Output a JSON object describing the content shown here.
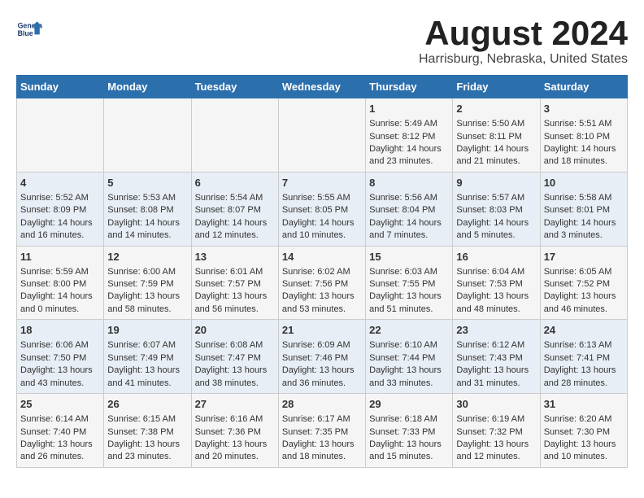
{
  "header": {
    "logo_line1": "General",
    "logo_line2": "Blue",
    "main_title": "August 2024",
    "subtitle": "Harrisburg, Nebraska, United States"
  },
  "days_of_week": [
    "Sunday",
    "Monday",
    "Tuesday",
    "Wednesday",
    "Thursday",
    "Friday",
    "Saturday"
  ],
  "weeks": [
    [
      {
        "day": "",
        "sunrise": "",
        "sunset": "",
        "daylight": ""
      },
      {
        "day": "",
        "sunrise": "",
        "sunset": "",
        "daylight": ""
      },
      {
        "day": "",
        "sunrise": "",
        "sunset": "",
        "daylight": ""
      },
      {
        "day": "",
        "sunrise": "",
        "sunset": "",
        "daylight": ""
      },
      {
        "day": "1",
        "sunrise": "Sunrise: 5:49 AM",
        "sunset": "Sunset: 8:12 PM",
        "daylight": "Daylight: 14 hours and 23 minutes."
      },
      {
        "day": "2",
        "sunrise": "Sunrise: 5:50 AM",
        "sunset": "Sunset: 8:11 PM",
        "daylight": "Daylight: 14 hours and 21 minutes."
      },
      {
        "day": "3",
        "sunrise": "Sunrise: 5:51 AM",
        "sunset": "Sunset: 8:10 PM",
        "daylight": "Daylight: 14 hours and 18 minutes."
      }
    ],
    [
      {
        "day": "4",
        "sunrise": "Sunrise: 5:52 AM",
        "sunset": "Sunset: 8:09 PM",
        "daylight": "Daylight: 14 hours and 16 minutes."
      },
      {
        "day": "5",
        "sunrise": "Sunrise: 5:53 AM",
        "sunset": "Sunset: 8:08 PM",
        "daylight": "Daylight: 14 hours and 14 minutes."
      },
      {
        "day": "6",
        "sunrise": "Sunrise: 5:54 AM",
        "sunset": "Sunset: 8:07 PM",
        "daylight": "Daylight: 14 hours and 12 minutes."
      },
      {
        "day": "7",
        "sunrise": "Sunrise: 5:55 AM",
        "sunset": "Sunset: 8:05 PM",
        "daylight": "Daylight: 14 hours and 10 minutes."
      },
      {
        "day": "8",
        "sunrise": "Sunrise: 5:56 AM",
        "sunset": "Sunset: 8:04 PM",
        "daylight": "Daylight: 14 hours and 7 minutes."
      },
      {
        "day": "9",
        "sunrise": "Sunrise: 5:57 AM",
        "sunset": "Sunset: 8:03 PM",
        "daylight": "Daylight: 14 hours and 5 minutes."
      },
      {
        "day": "10",
        "sunrise": "Sunrise: 5:58 AM",
        "sunset": "Sunset: 8:01 PM",
        "daylight": "Daylight: 14 hours and 3 minutes."
      }
    ],
    [
      {
        "day": "11",
        "sunrise": "Sunrise: 5:59 AM",
        "sunset": "Sunset: 8:00 PM",
        "daylight": "Daylight: 14 hours and 0 minutes."
      },
      {
        "day": "12",
        "sunrise": "Sunrise: 6:00 AM",
        "sunset": "Sunset: 7:59 PM",
        "daylight": "Daylight: 13 hours and 58 minutes."
      },
      {
        "day": "13",
        "sunrise": "Sunrise: 6:01 AM",
        "sunset": "Sunset: 7:57 PM",
        "daylight": "Daylight: 13 hours and 56 minutes."
      },
      {
        "day": "14",
        "sunrise": "Sunrise: 6:02 AM",
        "sunset": "Sunset: 7:56 PM",
        "daylight": "Daylight: 13 hours and 53 minutes."
      },
      {
        "day": "15",
        "sunrise": "Sunrise: 6:03 AM",
        "sunset": "Sunset: 7:55 PM",
        "daylight": "Daylight: 13 hours and 51 minutes."
      },
      {
        "day": "16",
        "sunrise": "Sunrise: 6:04 AM",
        "sunset": "Sunset: 7:53 PM",
        "daylight": "Daylight: 13 hours and 48 minutes."
      },
      {
        "day": "17",
        "sunrise": "Sunrise: 6:05 AM",
        "sunset": "Sunset: 7:52 PM",
        "daylight": "Daylight: 13 hours and 46 minutes."
      }
    ],
    [
      {
        "day": "18",
        "sunrise": "Sunrise: 6:06 AM",
        "sunset": "Sunset: 7:50 PM",
        "daylight": "Daylight: 13 hours and 43 minutes."
      },
      {
        "day": "19",
        "sunrise": "Sunrise: 6:07 AM",
        "sunset": "Sunset: 7:49 PM",
        "daylight": "Daylight: 13 hours and 41 minutes."
      },
      {
        "day": "20",
        "sunrise": "Sunrise: 6:08 AM",
        "sunset": "Sunset: 7:47 PM",
        "daylight": "Daylight: 13 hours and 38 minutes."
      },
      {
        "day": "21",
        "sunrise": "Sunrise: 6:09 AM",
        "sunset": "Sunset: 7:46 PM",
        "daylight": "Daylight: 13 hours and 36 minutes."
      },
      {
        "day": "22",
        "sunrise": "Sunrise: 6:10 AM",
        "sunset": "Sunset: 7:44 PM",
        "daylight": "Daylight: 13 hours and 33 minutes."
      },
      {
        "day": "23",
        "sunrise": "Sunrise: 6:12 AM",
        "sunset": "Sunset: 7:43 PM",
        "daylight": "Daylight: 13 hours and 31 minutes."
      },
      {
        "day": "24",
        "sunrise": "Sunrise: 6:13 AM",
        "sunset": "Sunset: 7:41 PM",
        "daylight": "Daylight: 13 hours and 28 minutes."
      }
    ],
    [
      {
        "day": "25",
        "sunrise": "Sunrise: 6:14 AM",
        "sunset": "Sunset: 7:40 PM",
        "daylight": "Daylight: 13 hours and 26 minutes."
      },
      {
        "day": "26",
        "sunrise": "Sunrise: 6:15 AM",
        "sunset": "Sunset: 7:38 PM",
        "daylight": "Daylight: 13 hours and 23 minutes."
      },
      {
        "day": "27",
        "sunrise": "Sunrise: 6:16 AM",
        "sunset": "Sunset: 7:36 PM",
        "daylight": "Daylight: 13 hours and 20 minutes."
      },
      {
        "day": "28",
        "sunrise": "Sunrise: 6:17 AM",
        "sunset": "Sunset: 7:35 PM",
        "daylight": "Daylight: 13 hours and 18 minutes."
      },
      {
        "day": "29",
        "sunrise": "Sunrise: 6:18 AM",
        "sunset": "Sunset: 7:33 PM",
        "daylight": "Daylight: 13 hours and 15 minutes."
      },
      {
        "day": "30",
        "sunrise": "Sunrise: 6:19 AM",
        "sunset": "Sunset: 7:32 PM",
        "daylight": "Daylight: 13 hours and 12 minutes."
      },
      {
        "day": "31",
        "sunrise": "Sunrise: 6:20 AM",
        "sunset": "Sunset: 7:30 PM",
        "daylight": "Daylight: 13 hours and 10 minutes."
      }
    ]
  ]
}
